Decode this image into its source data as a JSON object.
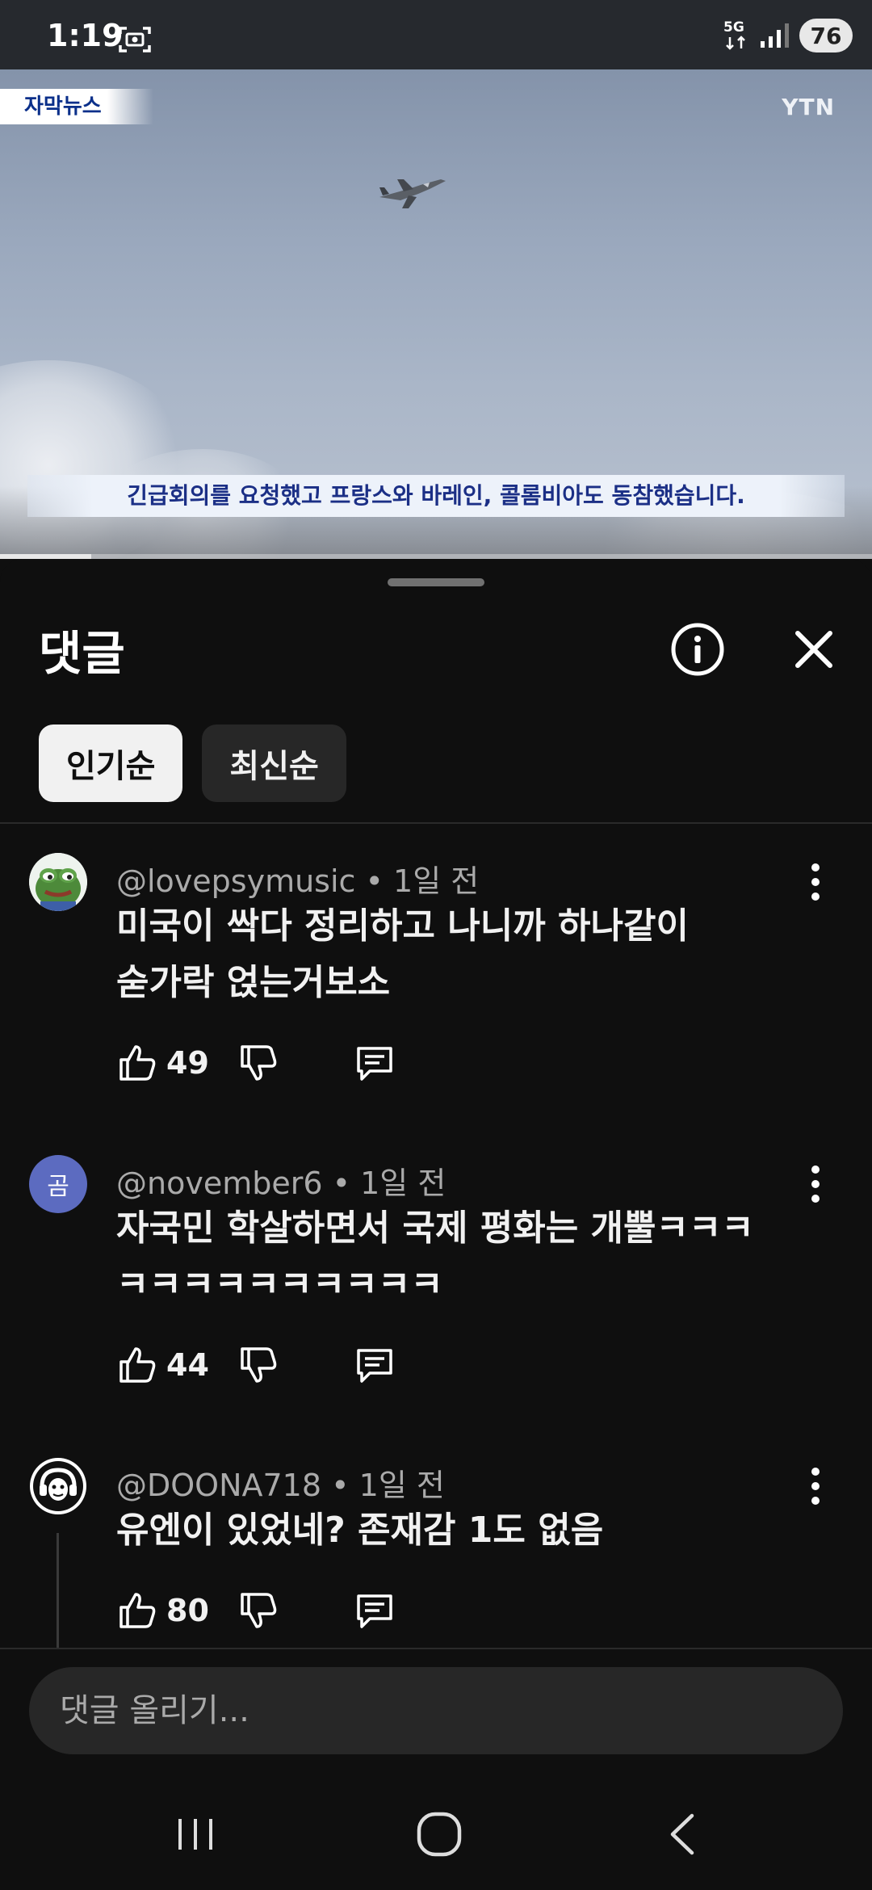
{
  "status": {
    "time": "1:19",
    "network": "5G",
    "battery": "76"
  },
  "video": {
    "news_tag": "자막뉴스",
    "channel_logo": "YTN",
    "caption": "긴급회의를 요청했고 프랑스와 바레인, 콜롬비아도 동참했습니다.",
    "progress": 0.105
  },
  "sheet": {
    "title": "댓글",
    "chips": [
      "인기순",
      "최신순"
    ],
    "active_chip": "인기순"
  },
  "comments": [
    {
      "author": "@lovepsymusic",
      "time": "1일 전",
      "lines": [
        "미국이 싹다 정리하고 나니까 하나같이",
        "숟가락 얹는거보소"
      ],
      "likes": "49",
      "avatar": "frog-avatar"
    },
    {
      "author": "@november6",
      "time": "1일 전",
      "lines": [
        "자국민 학살하면서 국제 평화는 개뿔ㅋㅋㅋ",
        "ㅋㅋㅋㅋㅋㅋㅋㅋㅋㅋ"
      ],
      "likes": "44",
      "avatar_letter": "곰",
      "avatar_color": "#5c6bc0"
    },
    {
      "author": "@DOONA718",
      "time": "1일 전",
      "lines": [
        "유엔이 있었네? 존재감 1도 없음"
      ],
      "likes": "80",
      "avatar": "headphone-logo-avatar"
    }
  ],
  "input": {
    "placeholder": "댓글 올리기..."
  },
  "nav": [
    "recent-apps",
    "home",
    "back"
  ]
}
